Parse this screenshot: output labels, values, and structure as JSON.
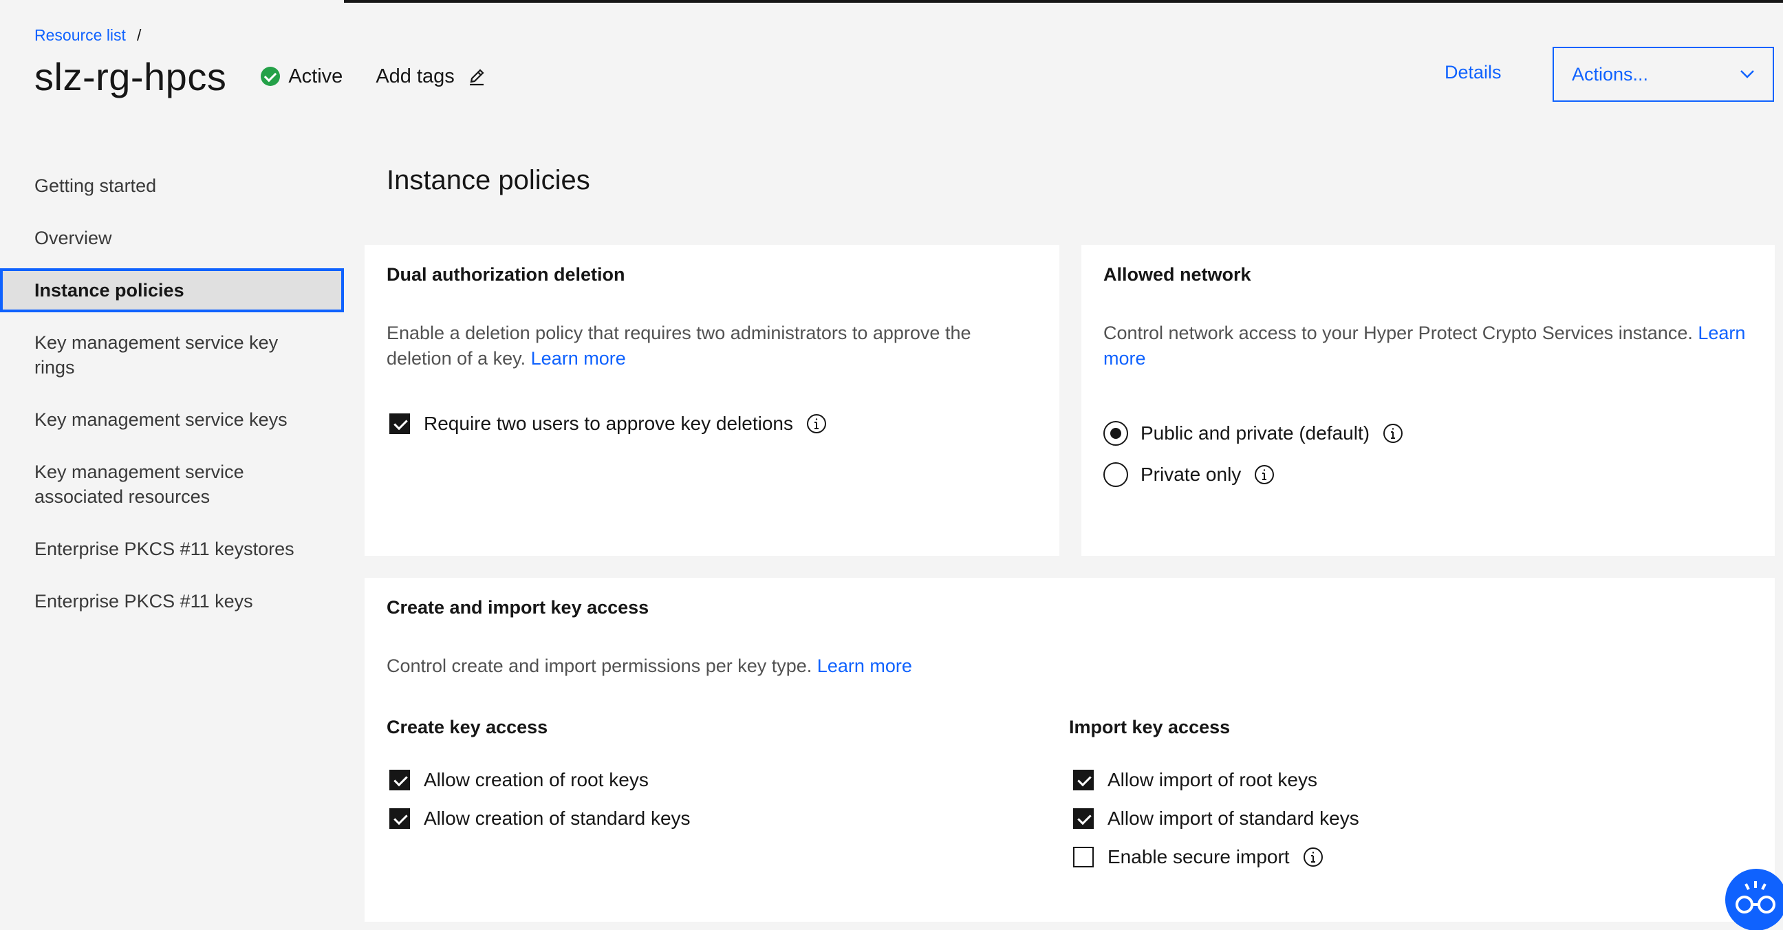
{
  "breadcrumb": {
    "link": "Resource list",
    "separator": "/"
  },
  "header": {
    "title": "slz-rg-hpcs",
    "status": "Active",
    "add_tags": "Add tags",
    "details": "Details",
    "actions": "Actions..."
  },
  "colors": {
    "accent": "#0f62fe",
    "success": "#24a148",
    "background": "#f4f4f4",
    "card": "#ffffff",
    "text": "#161616"
  },
  "sidebar": {
    "items": [
      {
        "label": "Getting started"
      },
      {
        "label": "Overview"
      },
      {
        "label": "Instance policies",
        "active": true
      },
      {
        "label": "Key management service key rings"
      },
      {
        "label": "Key management service keys"
      },
      {
        "label": "Key management service associated resources"
      },
      {
        "label": "Enterprise PKCS #11 keystores"
      },
      {
        "label": "Enterprise PKCS #11 keys"
      }
    ]
  },
  "main": {
    "title": "Instance policies",
    "dual_auth": {
      "title": "Dual authorization deletion",
      "description": "Enable a deletion policy that requires two administrators to approve the deletion of a key.",
      "learn_more": "Learn more",
      "checkbox": {
        "label": "Require two users to approve key deletions",
        "checked": true
      }
    },
    "allowed_network": {
      "title": "Allowed network",
      "description": "Control network access to your Hyper Protect Crypto Services instance.",
      "learn_more": "Learn more",
      "options": [
        {
          "label": "Public and private (default)",
          "selected": true
        },
        {
          "label": "Private only",
          "selected": false
        }
      ]
    },
    "key_access": {
      "title": "Create and import key access",
      "description": "Control create and import permissions per key type.",
      "learn_more": "Learn more",
      "create": {
        "title": "Create key access",
        "options": [
          {
            "label": "Allow creation of root keys",
            "checked": true
          },
          {
            "label": "Allow creation of standard keys",
            "checked": true
          }
        ]
      },
      "import": {
        "title": "Import key access",
        "options": [
          {
            "label": "Allow import of root keys",
            "checked": true
          },
          {
            "label": "Allow import of standard keys",
            "checked": true
          },
          {
            "label": "Enable secure import",
            "checked": false
          }
        ]
      }
    }
  },
  "icons": {
    "edit": "pencil-icon",
    "chevron": "chevron-down-icon",
    "info": "info-icon",
    "status": "checkmark-filled-icon",
    "assistant": "assistant-icon"
  }
}
